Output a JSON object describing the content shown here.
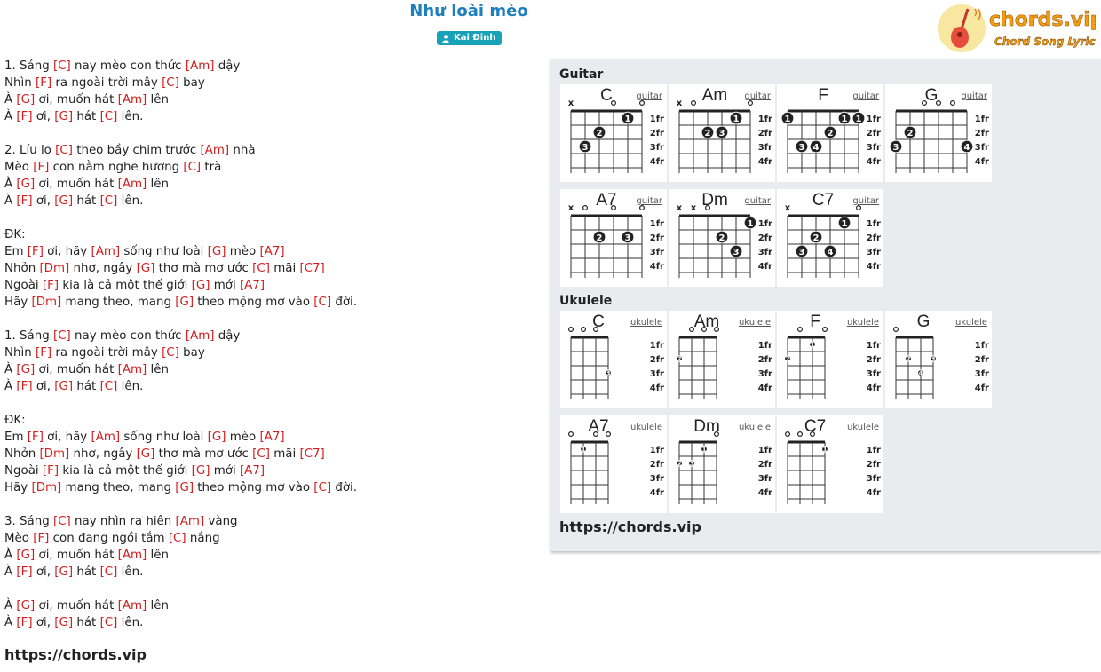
{
  "song": {
    "title": "Như loài mèo",
    "artist": "Kai Đinh"
  },
  "logo": {
    "text": "chords.vip",
    "tagline": "Chord Song Lyric"
  },
  "lyrics": [
    [
      {
        "t": "1. Sáng "
      },
      {
        "c": "[C]"
      },
      {
        "t": " nay mèo con thức "
      },
      {
        "c": "[Am]"
      },
      {
        "t": " dậy"
      }
    ],
    [
      {
        "t": "Nhìn "
      },
      {
        "c": "[F]"
      },
      {
        "t": " ra ngoài trời mây "
      },
      {
        "c": "[C]"
      },
      {
        "t": " bay"
      }
    ],
    [
      {
        "t": "À "
      },
      {
        "c": "[G]"
      },
      {
        "t": " ơi, muốn hát "
      },
      {
        "c": "[Am]"
      },
      {
        "t": " lên"
      }
    ],
    [
      {
        "t": "À "
      },
      {
        "c": "[F]"
      },
      {
        "t": " ơi, "
      },
      {
        "c": "[G]"
      },
      {
        "t": " hát "
      },
      {
        "c": "[C]"
      },
      {
        "t": " lên."
      }
    ],
    [],
    [
      {
        "t": "2. Líu lo "
      },
      {
        "c": "[C]"
      },
      {
        "t": " theo bầy chim trước "
      },
      {
        "c": "[Am]"
      },
      {
        "t": " nhà"
      }
    ],
    [
      {
        "t": "Mèo "
      },
      {
        "c": "[F]"
      },
      {
        "t": " con nằm nghe hương "
      },
      {
        "c": "[C]"
      },
      {
        "t": " trà"
      }
    ],
    [
      {
        "t": "À "
      },
      {
        "c": "[G]"
      },
      {
        "t": " ơi, muốn hát "
      },
      {
        "c": "[Am]"
      },
      {
        "t": " lên"
      }
    ],
    [
      {
        "t": "À "
      },
      {
        "c": "[F]"
      },
      {
        "t": " ơi, "
      },
      {
        "c": "[G]"
      },
      {
        "t": " hát "
      },
      {
        "c": "[C]"
      },
      {
        "t": " lên."
      }
    ],
    [],
    [
      {
        "t": "ĐK:"
      }
    ],
    [
      {
        "t": "Em "
      },
      {
        "c": "[F]"
      },
      {
        "t": " ơi, hãy "
      },
      {
        "c": "[Am]"
      },
      {
        "t": " sống như loài "
      },
      {
        "c": "[G]"
      },
      {
        "t": " mèo "
      },
      {
        "c": "[A7]"
      }
    ],
    [
      {
        "t": "Nhởn "
      },
      {
        "c": "[Dm]"
      },
      {
        "t": " nhơ, ngây "
      },
      {
        "c": "[G]"
      },
      {
        "t": " thơ mà mơ ước "
      },
      {
        "c": "[C]"
      },
      {
        "t": " mãi "
      },
      {
        "c": "[C7]"
      }
    ],
    [
      {
        "t": "Ngoài "
      },
      {
        "c": "[F]"
      },
      {
        "t": " kia là cả một thế giới "
      },
      {
        "c": "[G]"
      },
      {
        "t": " mới "
      },
      {
        "c": "[A7]"
      }
    ],
    [
      {
        "t": "Hãy "
      },
      {
        "c": "[Dm]"
      },
      {
        "t": " mang theo, mang "
      },
      {
        "c": "[G]"
      },
      {
        "t": " theo mộng mơ vào "
      },
      {
        "c": "[C]"
      },
      {
        "t": " đời."
      }
    ],
    [],
    [
      {
        "t": "1. Sáng "
      },
      {
        "c": "[C]"
      },
      {
        "t": " nay mèo con thức "
      },
      {
        "c": "[Am]"
      },
      {
        "t": " dậy"
      }
    ],
    [
      {
        "t": "Nhìn "
      },
      {
        "c": "[F]"
      },
      {
        "t": " ra ngoài trời mây "
      },
      {
        "c": "[C]"
      },
      {
        "t": " bay"
      }
    ],
    [
      {
        "t": "À "
      },
      {
        "c": "[G]"
      },
      {
        "t": " ơi, muốn hát "
      },
      {
        "c": "[Am]"
      },
      {
        "t": " lên"
      }
    ],
    [
      {
        "t": "À "
      },
      {
        "c": "[F]"
      },
      {
        "t": " ơi, "
      },
      {
        "c": "[G]"
      },
      {
        "t": " hát "
      },
      {
        "c": "[C]"
      },
      {
        "t": " lên."
      }
    ],
    [],
    [
      {
        "t": "ĐK:"
      }
    ],
    [
      {
        "t": "Em "
      },
      {
        "c": "[F]"
      },
      {
        "t": " ơi, hãy "
      },
      {
        "c": "[Am]"
      },
      {
        "t": " sống như loài "
      },
      {
        "c": "[G]"
      },
      {
        "t": " mèo "
      },
      {
        "c": "[A7]"
      }
    ],
    [
      {
        "t": "Nhởn "
      },
      {
        "c": "[Dm]"
      },
      {
        "t": " nhơ, ngây "
      },
      {
        "c": "[G]"
      },
      {
        "t": " thơ mà mơ ước "
      },
      {
        "c": "[C]"
      },
      {
        "t": " mãi "
      },
      {
        "c": "[C7]"
      }
    ],
    [
      {
        "t": "Ngoài "
      },
      {
        "c": "[F]"
      },
      {
        "t": " kia là cả một thế giới "
      },
      {
        "c": "[G]"
      },
      {
        "t": " mới "
      },
      {
        "c": "[A7]"
      }
    ],
    [
      {
        "t": "Hãy "
      },
      {
        "c": "[Dm]"
      },
      {
        "t": " mang theo, mang "
      },
      {
        "c": "[G]"
      },
      {
        "t": " theo mộng mơ vào "
      },
      {
        "c": "[C]"
      },
      {
        "t": " đời."
      }
    ],
    [],
    [
      {
        "t": "3. Sáng "
      },
      {
        "c": "[C]"
      },
      {
        "t": " nay nhìn ra hiên "
      },
      {
        "c": "[Am]"
      },
      {
        "t": " vàng"
      }
    ],
    [
      {
        "t": "Mèo "
      },
      {
        "c": "[F]"
      },
      {
        "t": " con đang ngồi tắm "
      },
      {
        "c": "[C]"
      },
      {
        "t": " nắng"
      }
    ],
    [
      {
        "t": "À "
      },
      {
        "c": "[G]"
      },
      {
        "t": " ơi, muốn hát "
      },
      {
        "c": "[Am]"
      },
      {
        "t": " lên"
      }
    ],
    [
      {
        "t": "À "
      },
      {
        "c": "[F]"
      },
      {
        "t": " ơi, "
      },
      {
        "c": "[G]"
      },
      {
        "t": " hát "
      },
      {
        "c": "[C]"
      },
      {
        "t": " lên."
      }
    ],
    [],
    [
      {
        "t": "À "
      },
      {
        "c": "[G]"
      },
      {
        "t": " ơi, muốn hát "
      },
      {
        "c": "[Am]"
      },
      {
        "t": " lên"
      }
    ],
    [
      {
        "t": "À "
      },
      {
        "c": "[F]"
      },
      {
        "t": " ơi, "
      },
      {
        "c": "[G]"
      },
      {
        "t": " hát "
      },
      {
        "c": "[C]"
      },
      {
        "t": " lên."
      }
    ]
  ],
  "footer_url": "https://chords.vip",
  "panel_url": "https://chords.vip",
  "fret_labels": [
    "1fr",
    "2fr",
    "3fr",
    "4fr"
  ],
  "guitar": {
    "heading": "Guitar",
    "link_label": "guitar",
    "chords": [
      {
        "name": "C",
        "strings": [
          "x",
          3,
          2,
          "o",
          1,
          "o"
        ]
      },
      {
        "name": "Am",
        "strings": [
          "x",
          "o",
          2,
          2,
          1,
          "o"
        ]
      },
      {
        "name": "F",
        "strings": [
          1,
          3,
          3,
          2,
          1,
          1
        ]
      },
      {
        "name": "G",
        "strings": [
          3,
          2,
          "o",
          "o",
          "o",
          3
        ]
      },
      {
        "name": "A7",
        "strings": [
          "x",
          "o",
          2,
          "o",
          2,
          "o"
        ]
      },
      {
        "name": "Dm",
        "strings": [
          "x",
          "x",
          "o",
          2,
          3,
          1
        ]
      },
      {
        "name": "C7",
        "strings": [
          "x",
          3,
          2,
          3,
          1,
          "o"
        ]
      }
    ],
    "finger_numbers": {
      "C": [
        null,
        3,
        2,
        null,
        1,
        null
      ],
      "Am": [
        null,
        null,
        2,
        3,
        1,
        null
      ],
      "F": [
        1,
        3,
        4,
        2,
        1,
        1
      ],
      "G": [
        3,
        2,
        null,
        null,
        null,
        4
      ],
      "A7": [
        null,
        null,
        2,
        null,
        3,
        null
      ],
      "Dm": [
        null,
        null,
        null,
        2,
        3,
        1
      ],
      "C7": [
        null,
        3,
        2,
        4,
        1,
        null
      ]
    }
  },
  "ukulele": {
    "heading": "Ukulele",
    "link_label": "ukulele",
    "chords": [
      {
        "name": "C",
        "strings": [
          "o",
          "o",
          "o",
          3
        ],
        "fingers": [
          null,
          null,
          null,
          3
        ]
      },
      {
        "name": "Am",
        "strings": [
          2,
          "o",
          "o",
          "o"
        ],
        "fingers": [
          2,
          null,
          null,
          null
        ]
      },
      {
        "name": "F",
        "strings": [
          2,
          "o",
          1,
          "o"
        ],
        "fingers": [
          2,
          null,
          1,
          null
        ]
      },
      {
        "name": "G",
        "strings": [
          "o",
          2,
          3,
          2
        ],
        "fingers": [
          null,
          2,
          4,
          3
        ]
      },
      {
        "name": "A7",
        "strings": [
          "o",
          1,
          "o",
          "o"
        ],
        "fingers": [
          null,
          1,
          null,
          null
        ]
      },
      {
        "name": "Dm",
        "strings": [
          2,
          2,
          1,
          "o"
        ],
        "fingers": [
          2,
          3,
          1,
          null
        ]
      },
      {
        "name": "C7",
        "strings": [
          "o",
          "o",
          "o",
          1
        ],
        "fingers": [
          null,
          null,
          null,
          1
        ]
      }
    ]
  },
  "colors": {
    "title": "#1e7fbf",
    "chord_red": "#d21e1e",
    "badge": "#17a2b8",
    "panel_bg": "#e9ebee",
    "logo_orange": "#f39c12"
  }
}
